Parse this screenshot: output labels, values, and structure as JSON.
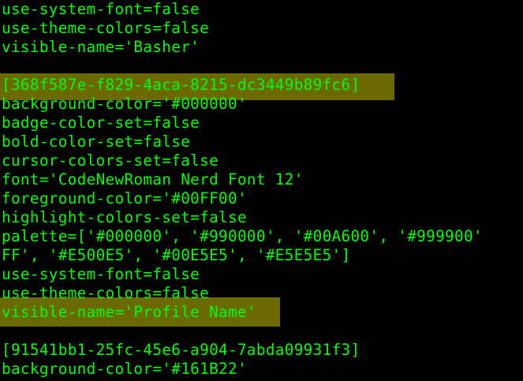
{
  "terminal": {
    "colors": {
      "background": "#000000",
      "foreground": "#00FF00",
      "highlight": "#6B6A00"
    },
    "lines": [
      "use-system-font=false",
      "use-theme-colors=false",
      "visible-name='Basher'",
      "",
      "[368f587e-f829-4aca-8215-dc3449b89fc6]",
      "background-color='#000000'",
      "badge-color-set=false",
      "bold-color-set=false",
      "cursor-colors-set=false",
      "font='CodeNewRoman Nerd Font 12'",
      "foreground-color='#00FF00'",
      "highlight-colors-set=false",
      "palette=['#000000', '#990000', '#00A600', '#999900'",
      "FF', '#E500E5', '#00E5E5', '#E5E5E5']",
      "use-system-font=false",
      "use-theme-colors=false",
      "visible-name='Profile Name'",
      "",
      "[91541bb1-25fc-45e6-a904-7abda09931f3]",
      "background-color='#161B22'"
    ],
    "highlighted_lines": [
      4,
      16
    ]
  }
}
